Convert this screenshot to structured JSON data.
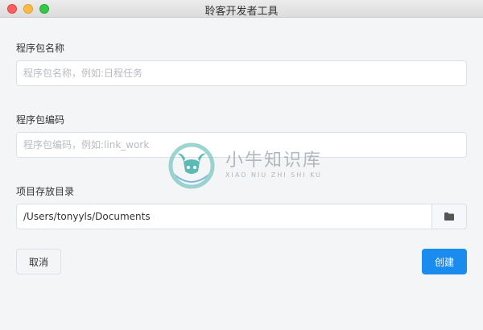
{
  "window": {
    "title": "聆客开发者工具"
  },
  "form": {
    "package_name": {
      "label": "程序包名称",
      "placeholder": "程序包名称，例如:日程任务",
      "value": ""
    },
    "package_code": {
      "label": "程序包编码",
      "placeholder": "程序包编码，例如:link_work",
      "value": ""
    },
    "directory": {
      "label": "项目存放目录",
      "value": "/Users/tonyyls/Documents",
      "browse_icon": "folder-icon"
    }
  },
  "actions": {
    "cancel_label": "取消",
    "create_label": "创建"
  },
  "watermark": {
    "title": "小牛知识库",
    "subtitle": "XIAO NIU ZHI SHI KU"
  },
  "colors": {
    "primary": "#1a8cf0",
    "close": "#fc605c",
    "minimize": "#fdbc40",
    "maximize": "#34c84a"
  }
}
